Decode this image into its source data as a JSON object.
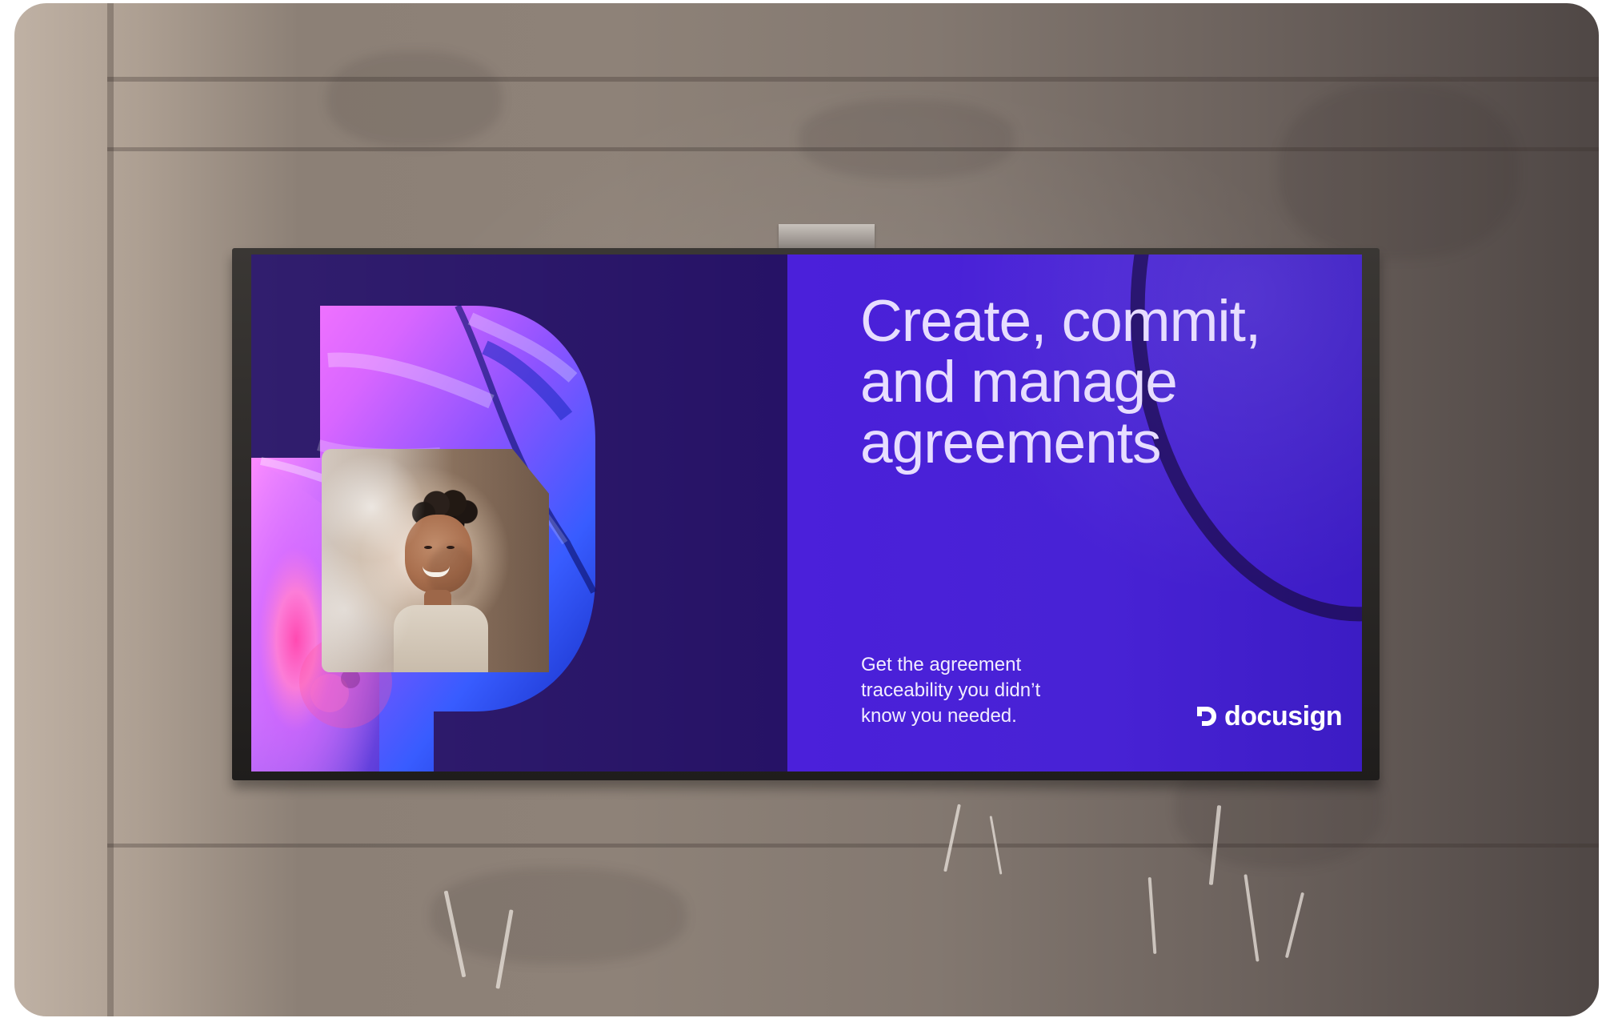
{
  "poster": {
    "headline": "Create, commit,\nand manage\nagreements",
    "subhead": "Get the agreement\ntraceability you didn’t\nknow you needed.",
    "brand": "docusign"
  },
  "colors": {
    "poster_left": "#261266",
    "poster_right": "#4b20da",
    "headline": "#e7ddff",
    "logo": "#ffffff",
    "accent_pink": "#df76ff",
    "accent_blue": "#2e58ff"
  },
  "icons": {
    "brand_mark": "docusign-logo-icon"
  }
}
